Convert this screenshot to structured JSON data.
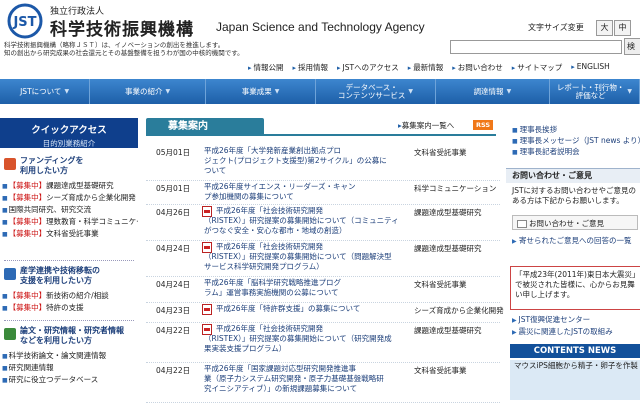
{
  "header": {
    "org_small": "独立行政法人",
    "org_name": "科学技術振興機構",
    "org_name_en": "Japan Science and Technology Agency",
    "logo_text": "JST",
    "tagline_1": "科学技術振興機構（略称ＪＳＴ）は、イノベーションの創出を推進します。",
    "tagline_2": "知の創出から研究成果の社会還元とその基盤整備を担うわが国の中核的機関です。",
    "font_size_label": "文字サイズ変更",
    "font_large": "大",
    "font_medium": "中",
    "search_button": "検"
  },
  "utility_links": [
    "情報公開",
    "採用情報",
    "JSTへのアクセス",
    "最新情報",
    "お問い合わせ",
    "サイトマップ",
    "ENGLISH"
  ],
  "gnav": [
    {
      "label": "JSTについて"
    },
    {
      "label": "事業の紹介"
    },
    {
      "label": "事業成果"
    },
    {
      "label": "データベース・\nコンテンツサービス"
    },
    {
      "label": "調達情報"
    },
    {
      "label": "レポート・刊行物・\n評価など"
    }
  ],
  "quick_access": {
    "title": "クイックアクセス",
    "subtitle": "目的別業務紹介"
  },
  "categories": [
    {
      "title": "ファンディングを\n利用したい方",
      "links": [
        {
          "tag": "【募集中】",
          "text": "課題達成型基礎研究"
        },
        {
          "tag": "【募集中】",
          "text": "シーズ育成から企業化開発"
        },
        {
          "tag": "",
          "text": "国際共同研究、研究交流"
        },
        {
          "tag": "【募集中】",
          "text": "理数教育・科学コミュニケーション"
        },
        {
          "tag": "【募集中】",
          "text": "文科省受託事業"
        }
      ]
    },
    {
      "title": "産学連携や技術移転の\n支援を利用したい方",
      "links": [
        {
          "tag": "【募集中】",
          "text": "新技術の紹介/相談"
        },
        {
          "tag": "【募集中】",
          "text": "特許の支援"
        }
      ]
    },
    {
      "title": "論文・研究情報・研究者情報\nなどを利用したい方",
      "links": [
        {
          "tag": "",
          "text": "科学技術論文・論文関連情報"
        },
        {
          "tag": "",
          "text": "研究関連情報"
        },
        {
          "tag": "",
          "text": "研究に役立つデータベース"
        }
      ]
    }
  ],
  "recruitment": {
    "title": "募集案内",
    "list_link": "募集案内一覧へ",
    "rss": "RSS",
    "items": [
      {
        "date": "05月01日",
        "pdf": false,
        "title": "平成26年度「大学発新産業創出拠点プロ\nジェクト(プロジェクト支援型)第2サイクル」の公募に\nついて",
        "dept": "文科省受託事業"
      },
      {
        "date": "05月01日",
        "pdf": false,
        "title": "平成26年度サイエンス・リーダーズ・キャン\nプ参加機関の募集について",
        "dept": "科学コミュニケーション"
      },
      {
        "date": "04月26日",
        "pdf": true,
        "title": "平成26年度「社会技術研究開発\n（RISTEX）」研究提案の募集開始について（コミュニティ\nがつなぐ安全・安心な都市・地域の創造）",
        "dept": "課題達成型基礎研究"
      },
      {
        "date": "04月24日",
        "pdf": true,
        "title": "平成26年度「社会技術研究開発\n（RISTEX）」研究提案の募集開始について（問題解決型\nサービス科学研究開発プログラム）",
        "dept": "課題達成型基礎研究"
      },
      {
        "date": "04月24日",
        "pdf": false,
        "title": "平成26年度「脳科学研究戦略推進プログ\nラム」運営事務実施機関の公募について",
        "dept": "文科省受託事業"
      },
      {
        "date": "04月23日",
        "pdf": true,
        "title": "平成26年度「特許群支援」の募集について",
        "dept": "シーズ育成から企業化開発"
      },
      {
        "date": "04月22日",
        "pdf": true,
        "title": "平成26年度「社会技術研究開発\n（RISTEX）」研究提案の募集開始について（研究開発成\n果実装支援プログラム）",
        "dept": "課題達成型基礎研究"
      },
      {
        "date": "04月22日",
        "pdf": false,
        "title": "平成26年度「国家課題対応型研究開発推進事\n業（原子力システム研究開発・原子力基礎基盤戦略研\n究イニシアティブ）」の新規課題募集について",
        "dept": "文科省受託事業"
      }
    ]
  },
  "right_sidebar": {
    "links_top": [
      "理事長挨拶",
      "理事長メッセージ（JST news より）",
      "理事長記者説明会"
    ],
    "contact_title": "お問い合わせ・ご意見",
    "contact_text": "JSTに対するお問い合わせやご意見のある方は下記からお願いします。",
    "contact_button": "お問い合わせ・ご意見",
    "ask_link": "寄せられたご意見への回答の一覧",
    "quake_text": "「平成23年(2011年)東日本大震災」で被災された皆様に、心からお見舞い申し上げます。",
    "quake_links": [
      "JST復興促進センター",
      "震災に関連したJSTの取組み"
    ],
    "contents_news_title": "CONTENTS NEWS",
    "contents_news_text": "マウスiPS細胞から精子・卵子を作製"
  },
  "colors": {
    "nav_blue": "#1d5fa8",
    "quick_access_navy": "#0f3f8c",
    "section_teal": "#2a7d9b",
    "tag_red": "#cc1111",
    "rss_orange": "#f07818"
  }
}
